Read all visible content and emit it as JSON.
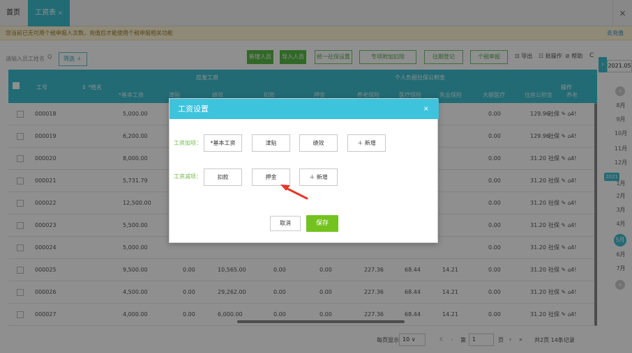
{
  "tabs": {
    "home": "首页",
    "active": "工资表",
    "active_close": "×",
    "window_close": "×"
  },
  "notice": {
    "text": "您当前已无可用个税申报人次数，充值后才能使用个税申报相关功能",
    "link": "去充值"
  },
  "toolbar": {
    "search_placeholder": "请输入员工姓名",
    "filter": "筛选 ＋",
    "buttons": [
      "新增人员",
      "导入人员",
      "统一社保设置",
      "专项附加扣除",
      "往期登记",
      "个税申报"
    ],
    "export": "导出",
    "batch": "批操作",
    "help": "帮助",
    "refresh": "C",
    "date": "2021.05"
  },
  "table": {
    "headers": {
      "id": "工号",
      "name": "*姓名",
      "group_salary": "应发工资",
      "group_social": "个人负担社保公积金",
      "ops": "操作",
      "sub": [
        "*基本工资",
        "津贴",
        "绩效",
        "扣款",
        "押金",
        "养老保险",
        "医疗保险",
        "失业保险",
        "大额医疗",
        "住房公积金",
        "养老"
      ]
    },
    "rows": [
      {
        "id": "000018",
        "name": "",
        "base": "5,000.00",
        "allow": "",
        "perf": "",
        "deduct": "",
        "deposit": "",
        "pension": "",
        "medical": "",
        "unemp": "",
        "big": "0.00",
        "housing": "129.96",
        "pen2": "4!"
      },
      {
        "id": "000019",
        "name": "",
        "base": "6,200.00",
        "allow": "",
        "perf": "",
        "deduct": "",
        "deposit": "",
        "pension": "",
        "medical": "",
        "unemp": "",
        "big": "0.00",
        "housing": "129.96",
        "pen2": "4!"
      },
      {
        "id": "000020",
        "name": "",
        "base": "8,000.00",
        "allow": "",
        "perf": "",
        "deduct": "",
        "deposit": "",
        "pension": "",
        "medical": "",
        "unemp": "",
        "big": "0.00",
        "housing": "31.20",
        "pen2": "4!"
      },
      {
        "id": "000021",
        "name": "",
        "base": "5,731.79",
        "allow": "",
        "perf": "",
        "deduct": "",
        "deposit": "",
        "pension": "",
        "medical": "",
        "unemp": "",
        "big": "0.00",
        "housing": "31.20",
        "pen2": "4!"
      },
      {
        "id": "000022",
        "name": "",
        "base": "12,500.00",
        "allow": "",
        "perf": "",
        "deduct": "",
        "deposit": "",
        "pension": "",
        "medical": "",
        "unemp": "",
        "big": "0.00",
        "housing": "31.20",
        "pen2": "4!"
      },
      {
        "id": "000023",
        "name": "",
        "base": "5,500.00",
        "allow": "",
        "perf": "",
        "deduct": "",
        "deposit": "",
        "pension": "",
        "medical": "",
        "unemp": "",
        "big": "0.00",
        "housing": "31.20",
        "pen2": "4!"
      },
      {
        "id": "000024",
        "name": "",
        "base": "5,000.00",
        "allow": "",
        "perf": "",
        "deduct": "",
        "deposit": "",
        "pension": "",
        "medical": "",
        "unemp": "",
        "big": "0.00",
        "housing": "31.20",
        "pen2": "4!"
      },
      {
        "id": "000025",
        "name": "",
        "base": "9,500.00",
        "allow": "0.00",
        "perf": "10,565.00",
        "deduct": "0.00",
        "deposit": "0.00",
        "pension": "227.36",
        "medical": "68.44",
        "unemp": "14.21",
        "big": "0.00",
        "housing": "31.20",
        "pen2": "4!"
      },
      {
        "id": "000026",
        "name": "",
        "base": "4,500.00",
        "allow": "0.00",
        "perf": "29,262.00",
        "deduct": "0.00",
        "deposit": "0.00",
        "pension": "227.36",
        "medical": "68.44",
        "unemp": "14.21",
        "big": "0.00",
        "housing": "31.20",
        "pen2": "4!"
      },
      {
        "id": "000027",
        "name": "",
        "base": "4,000.00",
        "allow": "0.00",
        "perf": "6,000.00",
        "deduct": "0.00",
        "deposit": "0.00",
        "pension": "227.36",
        "medical": "68.44",
        "unemp": "14.21",
        "big": "0.00",
        "housing": "31.20",
        "pen2": "4!"
      }
    ],
    "op_social": "社保"
  },
  "pager": {
    "per_page_label": "每页显示",
    "per_page": "10",
    "page_prefix": "第",
    "page": "1",
    "page_suffix": "页",
    "summary": "共2页 14条记录"
  },
  "months": [
    "8月",
    "9月",
    "10月",
    "11月",
    "12月",
    "2021",
    "1月",
    "2月",
    "3月",
    "4月",
    "5月",
    "6月",
    "7月"
  ],
  "dialog": {
    "title": "工资设置",
    "close": "×",
    "add_label": "工资加项：",
    "add_items": [
      "*基本工资",
      "津贴",
      "绩效",
      "＋ 新增"
    ],
    "sub_label": "工资减项：",
    "sub_items": [
      "扣款",
      "押金",
      "＋ 新增"
    ],
    "cancel": "取消",
    "save": "保存"
  },
  "colors": {
    "accent": "#3dbfcf",
    "dialog_header": "#3dc3dc",
    "save": "#73c21e",
    "arrow": "#e8352a"
  }
}
